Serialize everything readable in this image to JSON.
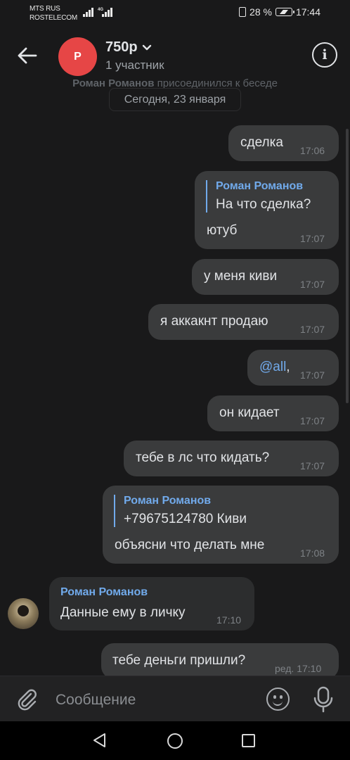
{
  "status_bar": {
    "carrier_1": "MTS RUS",
    "carrier_2": "ROSTELECOM",
    "network": "4G",
    "battery": "28 %",
    "time": "17:44"
  },
  "header": {
    "avatar_letter": "P",
    "avatar_color": "#e64646",
    "title": "750р",
    "subtitle": "1 участник"
  },
  "service_message": {
    "name": "Роман Романов",
    "text": " присоединился к беседе"
  },
  "date_separator": "Сегодня, 23 января",
  "messages": [
    {
      "text": "сделка",
      "time": "17:06"
    },
    {
      "reply_name": "Роман Романов",
      "reply_text": "На что сделка?",
      "text": "ютуб",
      "time": "17:07"
    },
    {
      "text": "у меня киви",
      "time": "17:07"
    },
    {
      "text": "я аккакнт продаю",
      "time": "17:07"
    },
    {
      "mention": "@all",
      "text": ",",
      "time": "17:07"
    },
    {
      "text": "он кидает",
      "time": "17:07"
    },
    {
      "text": "тебе в лс что кидать?",
      "time": "17:07"
    },
    {
      "reply_name": "Роман Романов",
      "reply_text": "+79675124780 Киви",
      "text": "объясни что делать мне",
      "time": "17:08"
    },
    {
      "sender": "Роман Романов",
      "text": "Данные ему в личку",
      "time": "17:10"
    },
    {
      "text": "тебе деньги пришли?",
      "time": "ред. 17:10"
    }
  ],
  "composer": {
    "placeholder": "Сообщение"
  },
  "colors": {
    "background": "#19191a",
    "bubble_out": "#3a3b3c",
    "bubble_in": "#2c2d2e",
    "accent": "#71aaeb"
  }
}
